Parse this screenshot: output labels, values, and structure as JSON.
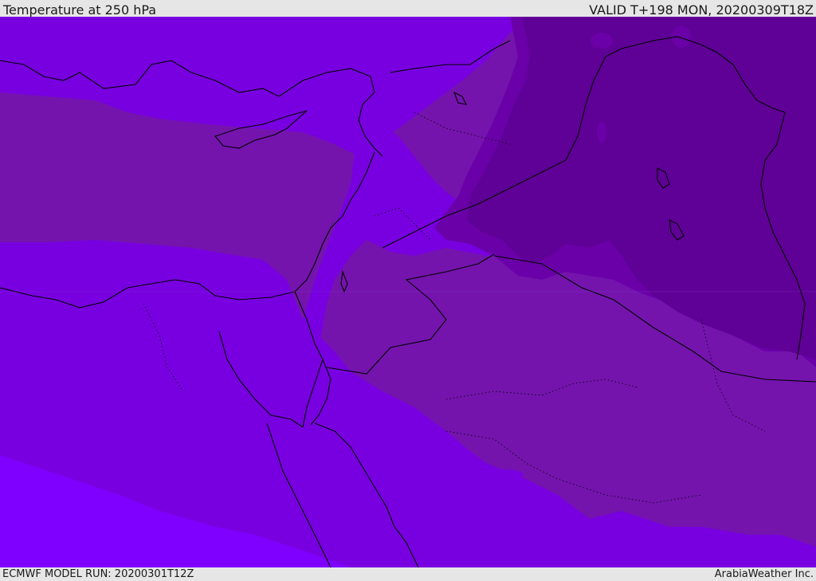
{
  "header": {
    "title": "Temperature at 250 hPa",
    "valid": "VALID T+198 MON, 20200309T18Z"
  },
  "footer": {
    "model_run": "ECMWF MODEL RUN: 20200301T12Z",
    "credit": "ArabiaWeather Inc."
  },
  "colors": {
    "band_lightest": "#7f00ff",
    "band_light": "#7800e0",
    "band_mid": "#7414ad",
    "band_dark": "#6a00a8",
    "band_darkest": "#5f0096",
    "coastline": "#000000",
    "background": "#e6e6e6"
  },
  "map": {
    "field": "Temperature",
    "level": "250 hPa",
    "region": "Eastern Mediterranean and Middle East"
  }
}
